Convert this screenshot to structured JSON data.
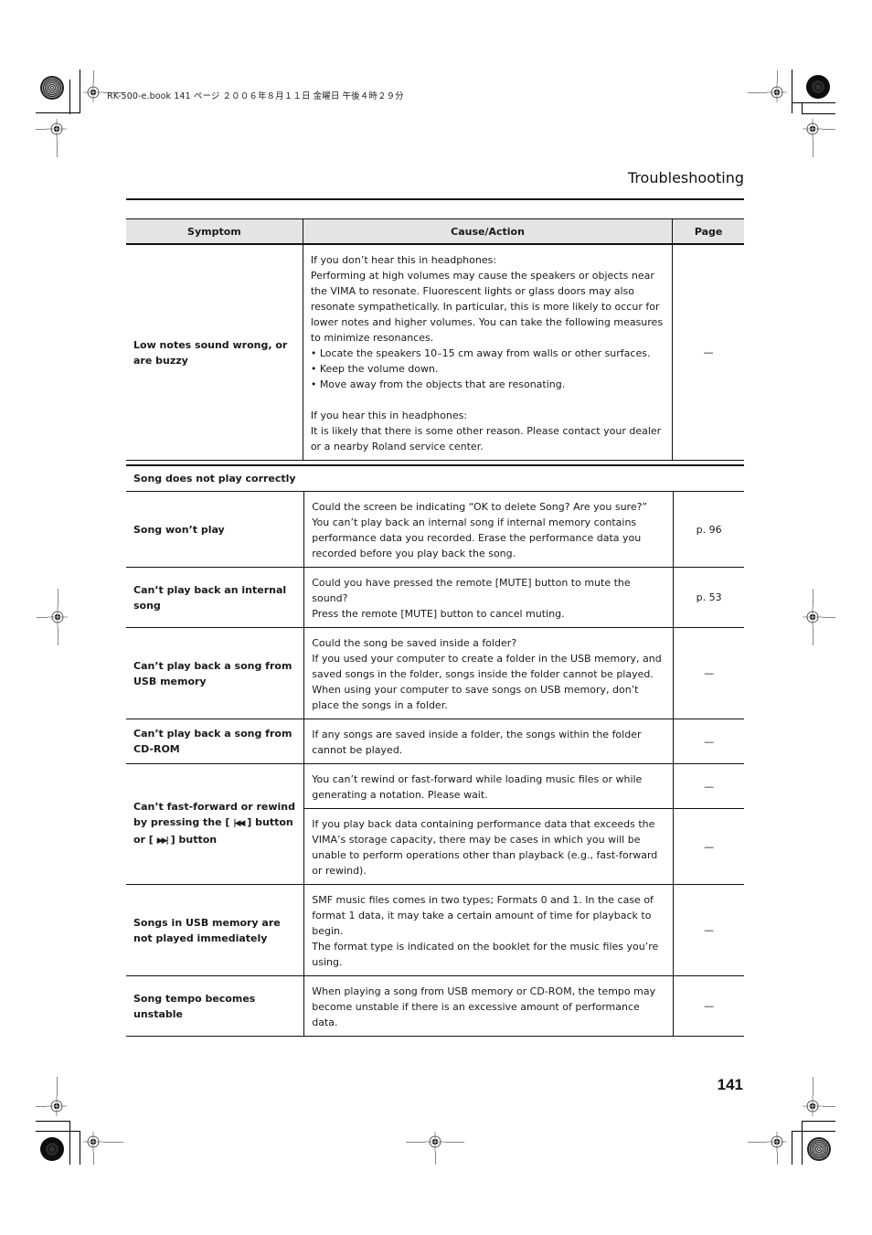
{
  "slug": "RK-500-e.book  141 ページ  ２００６年８月１１日  金曜日  午後４時２９分",
  "header": {
    "running_title": "Troubleshooting"
  },
  "table": {
    "columns": {
      "symptom": "Symptom",
      "cause": "Cause/Action",
      "page": "Page"
    },
    "rows_top": [
      {
        "symptom": "Low notes sound wrong, or are buzzy",
        "cause_lines": [
          "If you don’t hear this in headphones:",
          "Performing at high volumes may cause the speakers or objects near the VIMA to resonate. Fluorescent lights or glass doors may also resonate sympathetically. In particular, this is more likely to occur for lower notes and higher volumes. You can take the following measures to minimize resonances.",
          "• Locate the speakers 10–15 cm away from walls or other surfaces.",
          "• Keep the volume down.",
          "• Move away from the objects that are resonating.",
          "",
          "If you hear this in headphones:",
          "It is likely that there is some other reason. Please contact your dealer or a nearby Roland service center."
        ],
        "page": "—"
      }
    ],
    "section_title": "Song does not play correctly",
    "rows": [
      {
        "symptom": "Song won’t play",
        "cause_lines": [
          "Could the screen be indicating “OK to delete Song? Are you sure?”",
          "You can’t play back an internal song if internal memory contains performance data you recorded. Erase the performance data you recorded before you play back the song."
        ],
        "page": "p. 96"
      },
      {
        "symptom": "Can’t play back an internal song",
        "cause_lines": [
          "Could you have pressed the remote [MUTE] button to mute the sound?",
          "Press the remote [MUTE] button to cancel muting."
        ],
        "page": "p. 53"
      },
      {
        "symptom": "Can’t play back a song from USB memory",
        "cause_lines": [
          "Could the song be saved inside a folder?",
          "If you used your computer to create a folder in the USB memory, and saved songs in the folder, songs inside the folder cannot be played.",
          "When using your computer to save songs on USB memory, don’t place the songs in a folder."
        ],
        "page": "—"
      },
      {
        "symptom": "Can’t play back a song from CD-ROM",
        "cause_lines": [
          "If any songs are saved inside a folder, the songs within the folder cannot be played."
        ],
        "page": "—"
      },
      {
        "symptom_parts": {
          "before": "Can’t fast-forward or rewind by pressing the [ ",
          "rewind_glyph": "|◀◀",
          "middle": " ] button or [ ",
          "ff_glyph": "▶▶|",
          "after": " ] button"
        },
        "causes": [
          {
            "cause_lines": [
              "You can’t rewind or fast-forward while loading music files or while generating a notation. Please wait."
            ],
            "page": "—"
          },
          {
            "cause_lines": [
              "If you play back data containing performance data that exceeds the VIMA’s storage capacity, there may be cases in which you will be unable to perform operations other than playback (e.g., fast-forward or rewind)."
            ],
            "page": "—"
          }
        ]
      },
      {
        "symptom": "Songs in USB memory are not played immediately",
        "cause_lines": [
          "SMF music files comes in two types; Formats 0 and 1. In the case of format 1 data, it may take a certain amount of time for playback to begin.",
          "The format type is indicated on the booklet for the music files you’re using."
        ],
        "page": "—"
      },
      {
        "symptom": "Song tempo becomes unstable",
        "cause_lines": [
          "When playing a song from USB memory or CD-ROM, the tempo may become unstable if there is an excessive amount of performance data."
        ],
        "page": "—"
      }
    ]
  },
  "footer": {
    "page_number": "141"
  }
}
